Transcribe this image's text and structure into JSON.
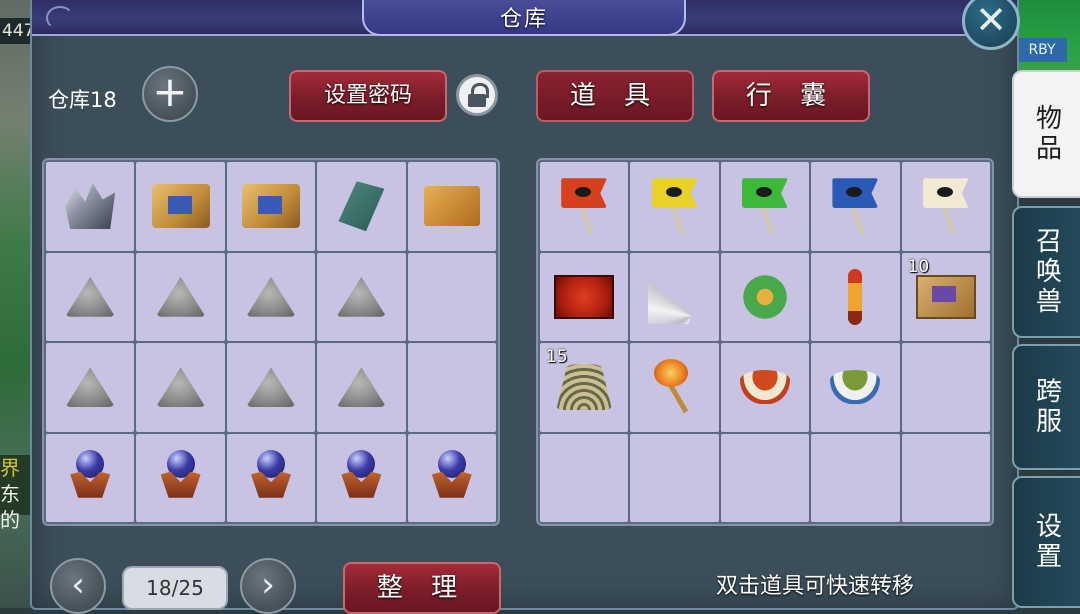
{
  "window": {
    "title": "仓库"
  },
  "backdrop": {
    "left_top_text": "447",
    "left_mid_text_1": "界",
    "left_mid_text_2": "东的",
    "right_top_text": "RBY"
  },
  "toolbar": {
    "warehouse_label": "仓库18",
    "add_button": "+",
    "set_password_label": "设置密码",
    "items_tab_label": "道 具",
    "bag_tab_label": "行 囊",
    "close_glyph": "✕"
  },
  "warehouse_grid": {
    "rows": 4,
    "cols": 5,
    "items": [
      {
        "icon": "crystal-ore-icon"
      },
      {
        "icon": "treasure-map-scroll-icon"
      },
      {
        "icon": "treasure-map-scroll-icon"
      },
      {
        "icon": "jade-belt-icon"
      },
      {
        "icon": "golden-map-icon"
      },
      {
        "icon": "stone-icon"
      },
      {
        "icon": "stone-icon"
      },
      {
        "icon": "stone-icon"
      },
      {
        "icon": "stone-icon"
      },
      {
        "icon": ""
      },
      {
        "icon": "stone-icon"
      },
      {
        "icon": "stone-icon"
      },
      {
        "icon": "stone-icon"
      },
      {
        "icon": "stone-icon"
      },
      {
        "icon": ""
      },
      {
        "icon": "blue-orb-icon"
      },
      {
        "icon": "blue-orb-icon"
      },
      {
        "icon": "blue-orb-icon"
      },
      {
        "icon": "blue-orb-icon"
      },
      {
        "icon": "blue-orb-icon"
      }
    ]
  },
  "inventory_grid": {
    "rows": 4,
    "cols": 5,
    "items": [
      {
        "icon": "red-flag-icon",
        "color": "#d6401c",
        "qty": ""
      },
      {
        "icon": "yellow-flag-icon",
        "color": "#e8d22a",
        "qty": ""
      },
      {
        "icon": "green-flag-icon",
        "color": "#3cb83a",
        "qty": ""
      },
      {
        "icon": "blue-flag-icon",
        "color": "#2a5ab8",
        "qty": ""
      },
      {
        "icon": "white-flag-icon",
        "color": "#f2ead2",
        "qty": ""
      },
      {
        "icon": "red-box-icon",
        "qty": ""
      },
      {
        "icon": "feather-fan-icon",
        "qty": ""
      },
      {
        "icon": "herb-icon",
        "qty": ""
      },
      {
        "icon": "bead-string-icon",
        "qty": ""
      },
      {
        "icon": "scroll-mat-icon",
        "qty": "10"
      },
      {
        "icon": "bamboo-hat-icon",
        "qty": "15"
      },
      {
        "icon": "fire-axe-icon",
        "qty": ""
      },
      {
        "icon": "red-bowl-icon",
        "qty": ""
      },
      {
        "icon": "blue-bowl-icon",
        "qty": ""
      },
      {
        "icon": "",
        "qty": ""
      },
      {
        "icon": "",
        "qty": ""
      },
      {
        "icon": "",
        "qty": ""
      },
      {
        "icon": "",
        "qty": ""
      },
      {
        "icon": "",
        "qty": ""
      },
      {
        "icon": "",
        "qty": ""
      }
    ]
  },
  "pager": {
    "page": "18/25",
    "prev_glyph": "‹",
    "next_glyph": "›"
  },
  "sort_button_label": "整 理",
  "hint_text": "双击道具可快速转移",
  "side_tabs": [
    {
      "label": "物品",
      "active": true
    },
    {
      "label": "召唤兽",
      "active": false
    },
    {
      "label": "跨服",
      "active": false
    },
    {
      "label": "设置",
      "active": false
    }
  ],
  "colors": {
    "panel": "#3b4e5a",
    "cell": "#c9c3e3",
    "button_red": "#8a2230",
    "title_bar": "#343886"
  }
}
